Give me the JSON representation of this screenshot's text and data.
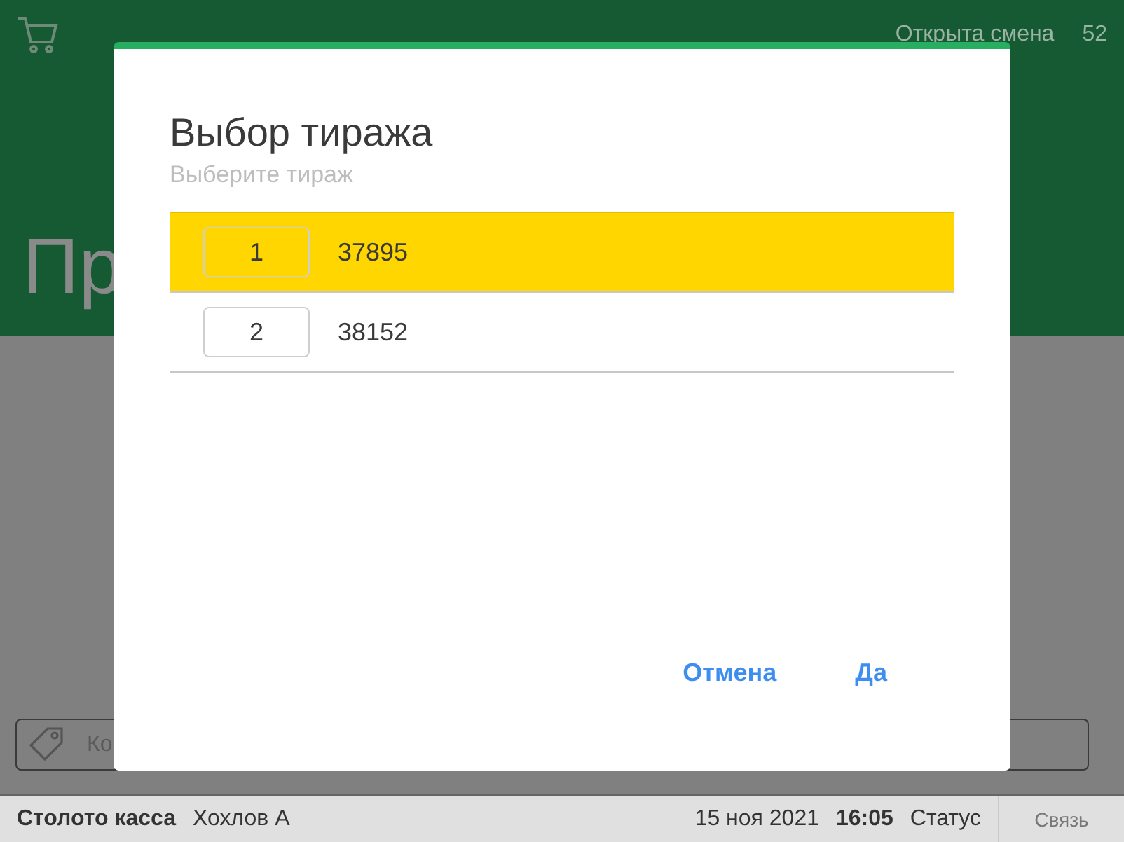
{
  "header": {
    "title": "Пр",
    "shift_status": "Открыта смена",
    "shift_number": "52"
  },
  "code_field": {
    "placeholder": "Ко"
  },
  "dialog": {
    "title": "Выбор тиража",
    "subtitle": "Выберите тираж",
    "draws": [
      {
        "index": "1",
        "number": "37895",
        "selected": true
      },
      {
        "index": "2",
        "number": "38152",
        "selected": false
      }
    ],
    "buttons": [
      {
        "label": "Отмена"
      },
      {
        "label": "Да"
      }
    ]
  },
  "status_bar": {
    "app": "Столото касса",
    "user": "Хохлов А",
    "date": "15 ноя 2021",
    "time": "16:05",
    "status": "Статус",
    "connection": "Связь"
  }
}
